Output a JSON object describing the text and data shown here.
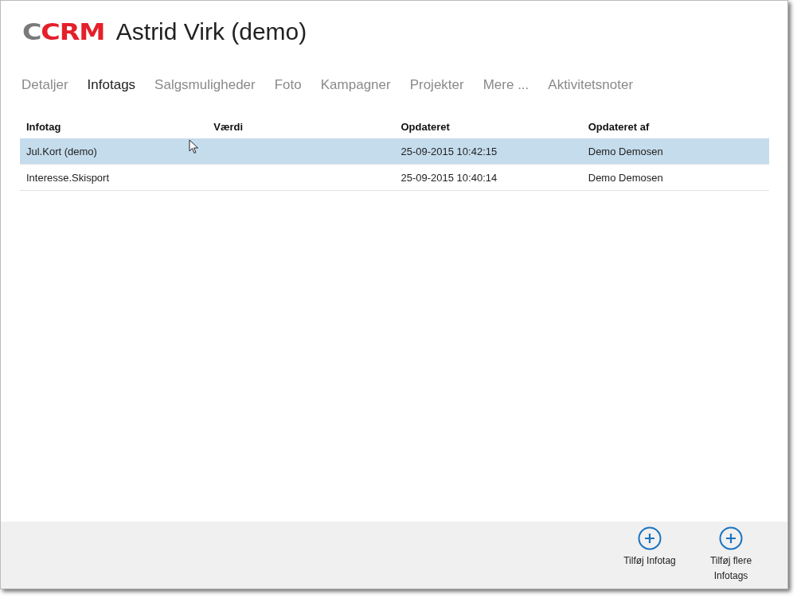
{
  "header": {
    "logo": [
      {
        "text": "C",
        "kind": "muted"
      },
      {
        "text": "CRM",
        "kind": "accent"
      }
    ],
    "title": "Astrid Virk (demo)"
  },
  "tabs": [
    {
      "label": "Detaljer",
      "selected": false
    },
    {
      "label": "Infotags",
      "selected": true
    },
    {
      "label": "Salgsmuligheder",
      "selected": false
    },
    {
      "label": "Foto",
      "selected": false
    },
    {
      "label": "Kampagner",
      "selected": false
    },
    {
      "label": "Projekter",
      "selected": false
    },
    {
      "label": "Mere ...",
      "selected": false
    },
    {
      "label": "Aktivitetsnoter",
      "selected": false
    }
  ],
  "table": {
    "columns": [
      "Infotag",
      "Værdi",
      "Opdateret",
      "Opdateret af"
    ],
    "rows": [
      {
        "cells": [
          "Jul.Kort (demo)",
          "",
          "25-09-2015 10:42:15",
          "Demo Demosen"
        ],
        "selected": true
      },
      {
        "cells": [
          "Interesse.Skisport",
          "",
          "25-09-2015 10:40:14",
          "Demo Demosen"
        ],
        "selected": false
      }
    ]
  },
  "footer": {
    "buttons": [
      {
        "label": "Tilføj Infotag"
      },
      {
        "label": "Tilføj flere Infotags"
      }
    ]
  }
}
